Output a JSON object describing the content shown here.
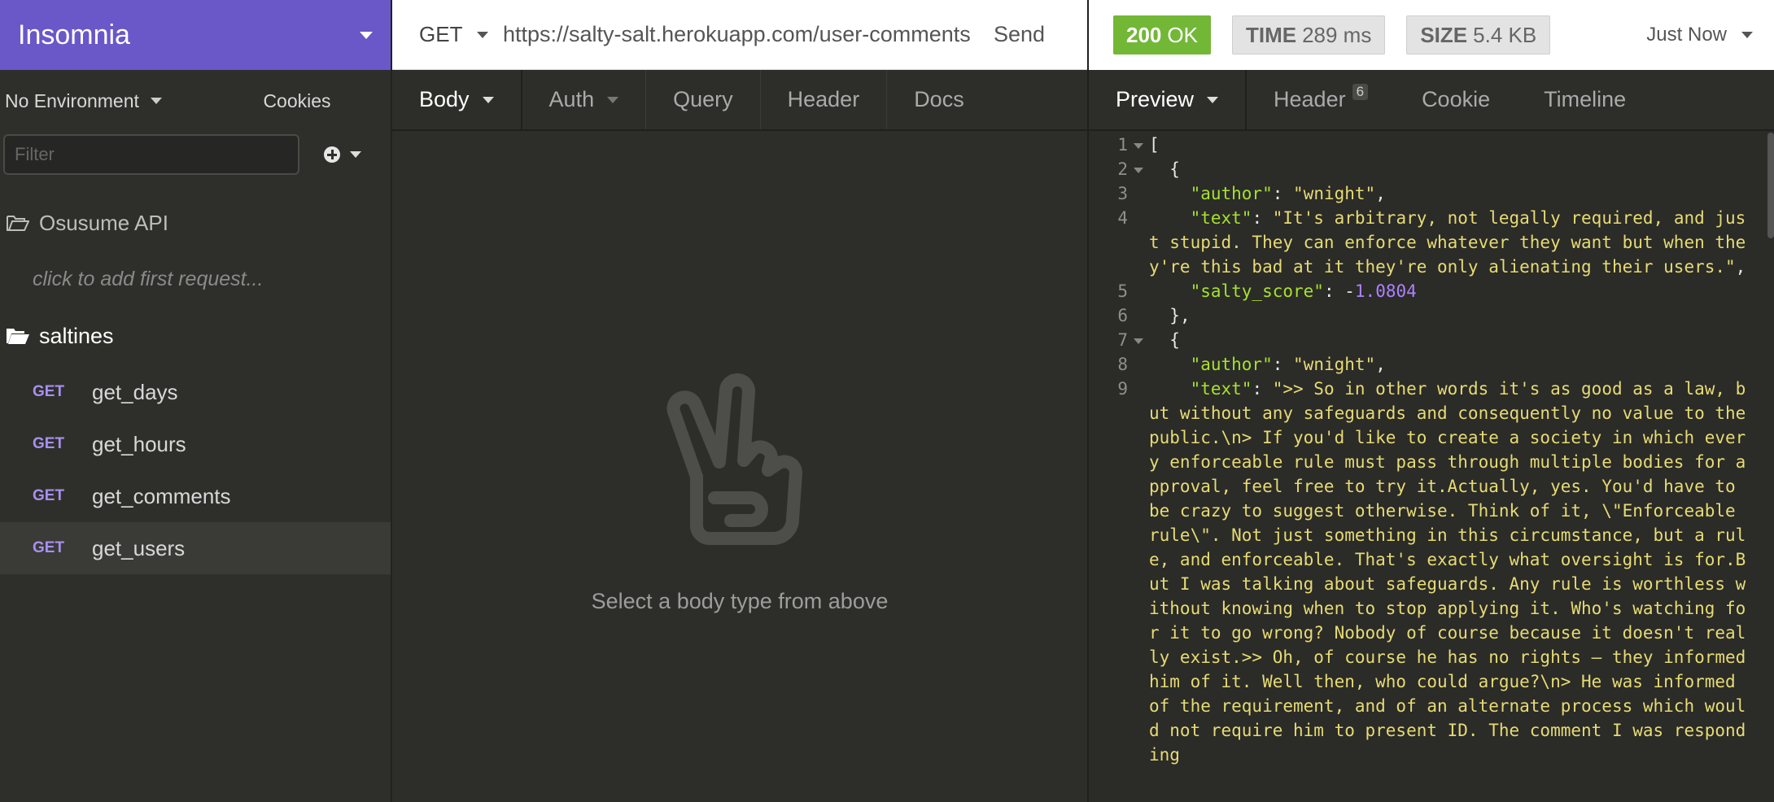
{
  "sidebar": {
    "title": "Insomnia",
    "environment": "No Environment",
    "cookies": "Cookies",
    "filter_placeholder": "Filter",
    "workspace": "Osusume API",
    "add_first_request": "click to add first request...",
    "folder": "saltines",
    "requests": [
      {
        "method": "GET",
        "name": "get_days"
      },
      {
        "method": "GET",
        "name": "get_hours"
      },
      {
        "method": "GET",
        "name": "get_comments"
      },
      {
        "method": "GET",
        "name": "get_users"
      }
    ]
  },
  "request": {
    "method": "GET",
    "url": "https://salty-salt.herokuapp.com/user-comments",
    "send_label": "Send",
    "tabs": [
      "Body",
      "Auth",
      "Query",
      "Header",
      "Docs"
    ],
    "empty_message": "Select a body type from above"
  },
  "response": {
    "status_code": "200",
    "status_text": "OK",
    "time_label": "TIME",
    "time_value": "289 ms",
    "size_label": "SIZE",
    "size_value": "5.4 KB",
    "time_ago": "Just Now",
    "tabs": [
      "Preview",
      "Header",
      "Cookie",
      "Timeline"
    ],
    "header_count": "6",
    "lines": [
      {
        "n": "1",
        "fold": true,
        "segs": [
          [
            "p",
            "["
          ]
        ]
      },
      {
        "n": "2",
        "fold": true,
        "segs": [
          [
            "p",
            "  {"
          ]
        ]
      },
      {
        "n": "3",
        "fold": false,
        "segs": [
          [
            "p",
            "    "
          ],
          [
            "k",
            "\"author\""
          ],
          [
            "p",
            ": "
          ],
          [
            "s",
            "\"wnight\""
          ],
          [
            "p",
            ","
          ]
        ]
      },
      {
        "n": "4",
        "fold": false,
        "segs": [
          [
            "p",
            "    "
          ],
          [
            "k",
            "\"text\""
          ],
          [
            "p",
            ": "
          ],
          [
            "s",
            "\"It's arbitrary, not legally required, and just stupid. They can enforce whatever they want but when they're this bad at it they're only alienating their users.\""
          ],
          [
            "p",
            ","
          ]
        ]
      },
      {
        "n": "5",
        "fold": false,
        "segs": [
          [
            "p",
            "    "
          ],
          [
            "k",
            "\"salty_score\""
          ],
          [
            "p",
            ": "
          ],
          [
            "p",
            "-"
          ],
          [
            "n",
            "1.0804"
          ]
        ]
      },
      {
        "n": "6",
        "fold": false,
        "segs": [
          [
            "p",
            "  },"
          ]
        ]
      },
      {
        "n": "7",
        "fold": true,
        "segs": [
          [
            "p",
            "  {"
          ]
        ]
      },
      {
        "n": "8",
        "fold": false,
        "segs": [
          [
            "p",
            "    "
          ],
          [
            "k",
            "\"author\""
          ],
          [
            "p",
            ": "
          ],
          [
            "s",
            "\"wnight\""
          ],
          [
            "p",
            ","
          ]
        ]
      },
      {
        "n": "9",
        "fold": false,
        "segs": [
          [
            "p",
            "    "
          ],
          [
            "k",
            "\"text\""
          ],
          [
            "p",
            ": "
          ],
          [
            "s",
            "\">> So in other words it's as good as a law, but without any safeguards and consequently no value to the public.\\n> If you'd like to create a society in which every enforceable rule must pass through multiple bodies for approval, feel free to try it.Actually, yes. You'd have to be crazy to suggest otherwise. Think of it, \\\"Enforceable rule\\\". Not just something in this circumstance, but a rule, and enforceable. That's exactly what oversight is for.But I was talking about safeguards. Any rule is worthless without knowing when to stop applying it. Who's watching for it to go wrong? Nobody of course because it doesn't really exist.>> Oh, of course he has no rights – they informed him of it. Well then, who could argue?\\n> He was informed of the requirement, and of an alternate process which would not require him to present ID. The comment I was responding"
          ]
        ]
      }
    ]
  }
}
